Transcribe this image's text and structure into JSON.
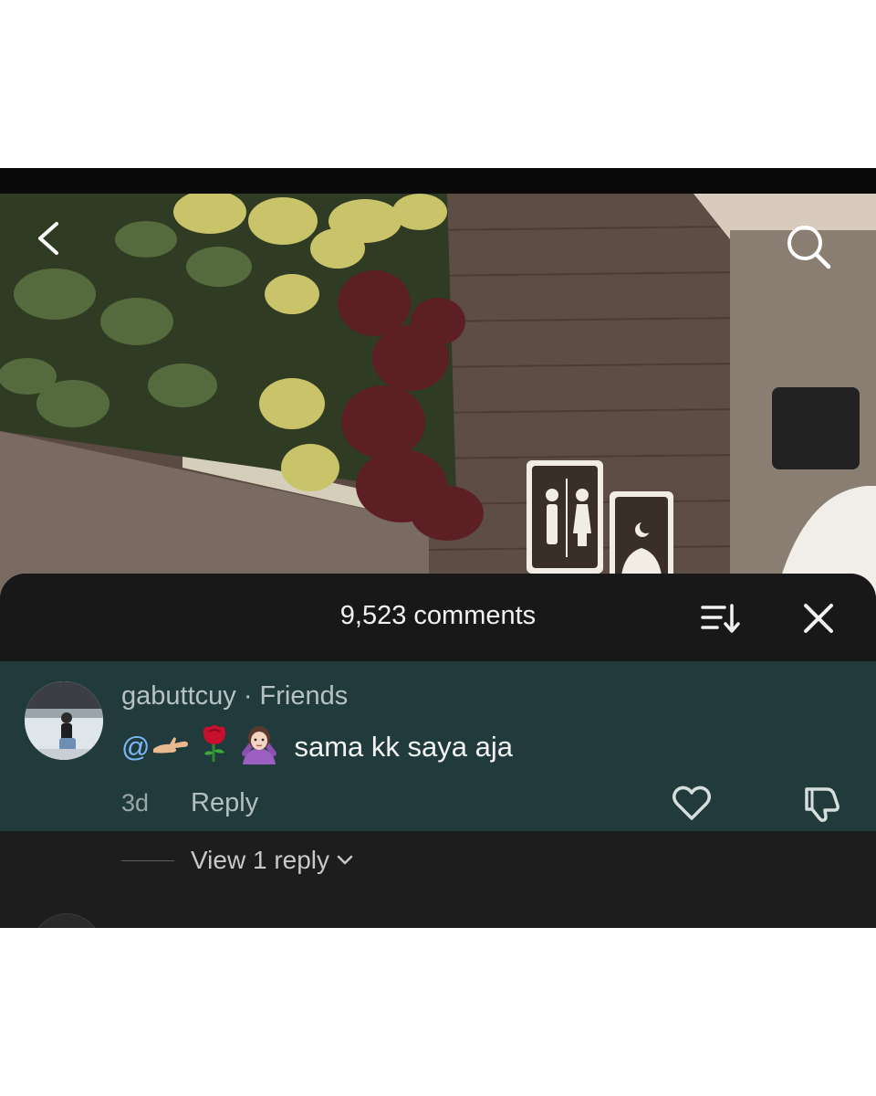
{
  "video": {
    "back_icon": "chevron-left-icon",
    "search_icon": "search-icon",
    "signs": [
      "restroom-sign-icon",
      "prayer-room-sign-icon"
    ]
  },
  "comments_panel": {
    "count_label": "9,523 comments",
    "sort_icon": "sort-icon",
    "close_icon": "close-icon"
  },
  "comment": {
    "username": "gabuttcuy",
    "separator": " · ",
    "relation": "Friends",
    "mention": "@",
    "emojis": [
      "hand-palm-up-emoji",
      "rose-emoji",
      "person-gesturing-no-emoji"
    ],
    "text": "sama kk saya aja",
    "time": "3d",
    "reply_label": "Reply",
    "like_icon": "heart-icon",
    "dislike_icon": "thumbs-down-icon"
  },
  "replies": {
    "label": "View 1 reply",
    "icon": "chevron-down-icon"
  },
  "colors": {
    "panel": "#1d1d1d",
    "highlight": "#213a3b",
    "mention": "#7ab8f5"
  }
}
